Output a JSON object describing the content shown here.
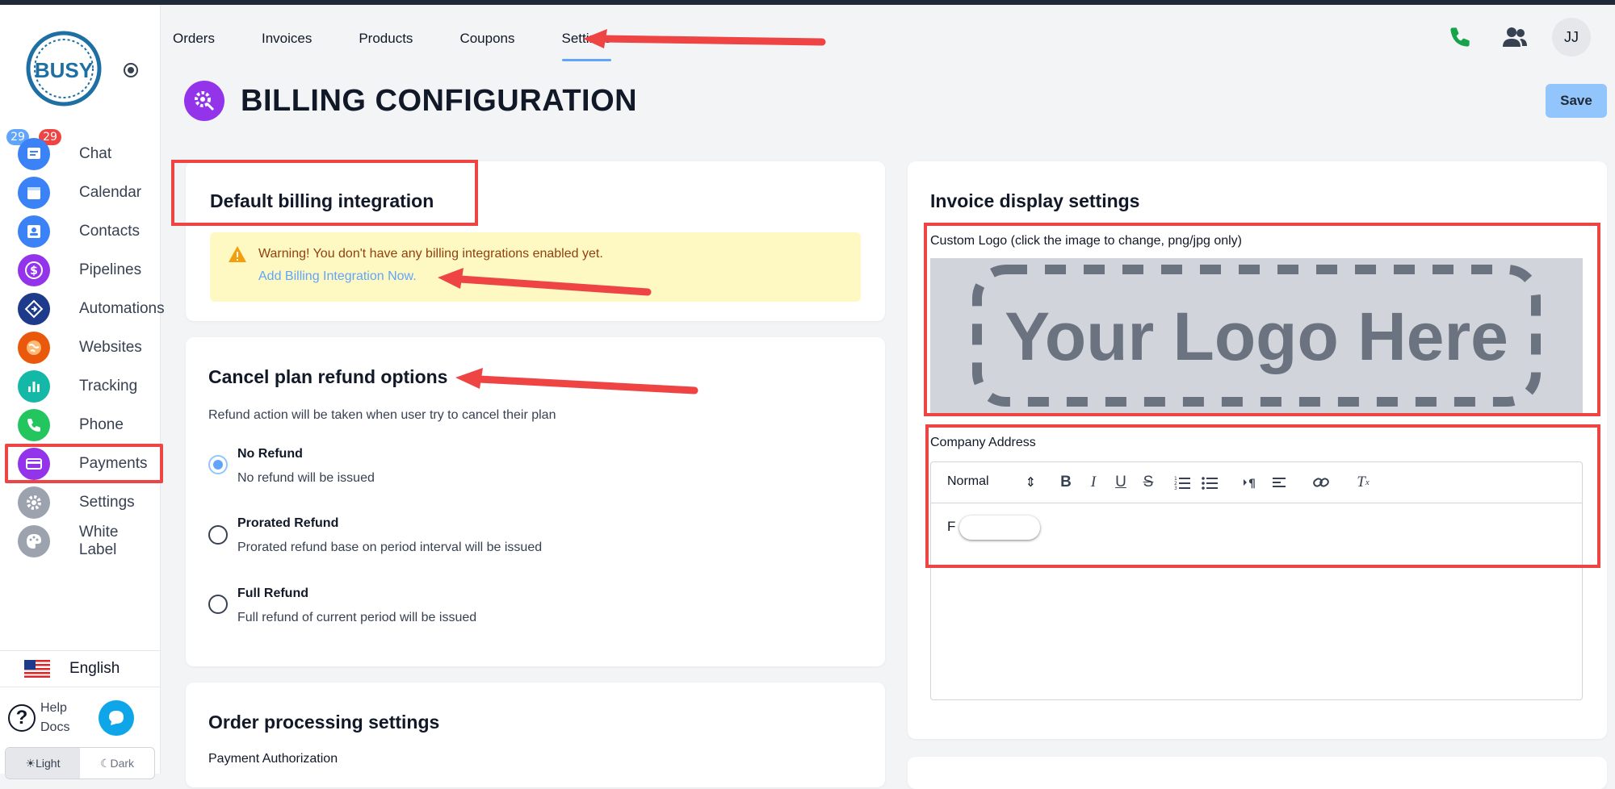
{
  "sidebar": {
    "badges": {
      "blue": "29",
      "red": "29"
    },
    "items": [
      {
        "label": "Chat",
        "icon": "chat-icon",
        "color": "#3b82f6"
      },
      {
        "label": "Calendar",
        "icon": "calendar-icon",
        "color": "#3b82f6"
      },
      {
        "label": "Contacts",
        "icon": "contacts-icon",
        "color": "#3b82f6"
      },
      {
        "label": "Pipelines",
        "icon": "dollar-icon",
        "color": "#9333ea"
      },
      {
        "label": "Automations",
        "icon": "automations-icon",
        "color": "#1e3a8a"
      },
      {
        "label": "Websites",
        "icon": "globe-icon",
        "color": "#ea580c"
      },
      {
        "label": "Tracking",
        "icon": "bar-chart-icon",
        "color": "#14b8a6"
      },
      {
        "label": "Phone",
        "icon": "phone-icon",
        "color": "#22c55e"
      },
      {
        "label": "Payments",
        "icon": "credit-card-icon",
        "color": "#9333ea"
      },
      {
        "label": "Settings",
        "icon": "gear-icon",
        "color": "#9ca3af"
      },
      {
        "label": "White Label",
        "icon": "palette-icon",
        "color": "#9ca3af"
      }
    ],
    "language": "English",
    "help_line1": "Help",
    "help_line2": "Docs",
    "theme_light": "Light",
    "theme_dark": "Dark"
  },
  "tabs": [
    "Orders",
    "Invoices",
    "Products",
    "Coupons",
    "Settings"
  ],
  "active_tab": "Settings",
  "user_initials": "JJ",
  "page_title": "BILLING CONFIGURATION",
  "save_label": "Save",
  "default_billing": {
    "title": "Default billing integration",
    "warning": "Warning! You don't have any billing integrations enabled yet.",
    "link": "Add Billing Integration Now."
  },
  "cancel_refund": {
    "title": "Cancel plan refund options",
    "description": "Refund action will be taken when user try to cancel their plan",
    "options": [
      {
        "title": "No Refund",
        "sub": "No refund will be issued",
        "checked": true
      },
      {
        "title": "Prorated Refund",
        "sub": "Prorated refund base on period interval will be issued",
        "checked": false
      },
      {
        "title": "Full Refund",
        "sub": "Full refund of current period will be issued",
        "checked": false
      }
    ]
  },
  "order_processing": {
    "title": "Order processing settings",
    "payment_auth_label": "Payment Authorization"
  },
  "invoice_display": {
    "title": "Invoice display settings",
    "custom_logo_label": "Custom Logo (click the image to change, png/jpg only)",
    "logo_placeholder": "Your Logo Here",
    "company_address_label": "Company Address",
    "editor_format": "Normal",
    "editor_text": "F"
  },
  "colors": {
    "accent": "#60a5fa",
    "highlight": "#ef4444",
    "warning_bg": "#fef9c3",
    "purple": "#9333ea"
  }
}
